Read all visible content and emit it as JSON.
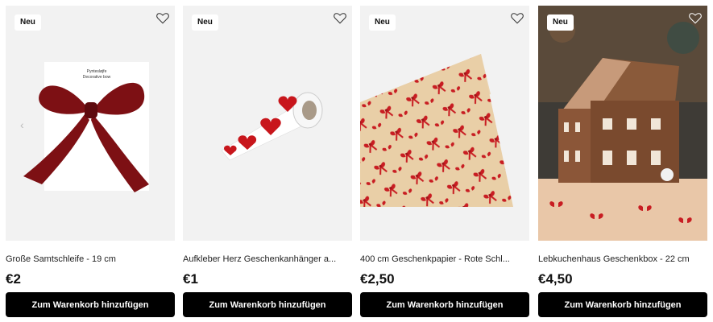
{
  "products": [
    {
      "badge": "Neu",
      "title": "Große Samtschleife - 19 cm",
      "price": "€2",
      "button": "Zum Warenkorb hinzufügen",
      "package_text": "Pyntesløjfe\nDecorative bow"
    },
    {
      "badge": "Neu",
      "title": "Aufkleber Herz Geschenkanhänger a...",
      "price": "€1",
      "button": "Zum Warenkorb hinzufügen"
    },
    {
      "badge": "Neu",
      "title": "400 cm Geschenkpapier - Rote Schl...",
      "price": "€2,50",
      "button": "Zum Warenkorb hinzufügen"
    },
    {
      "badge": "Neu",
      "title": "Lebkuchenhaus Geschenkbox - 22 cm",
      "price": "€4,50",
      "button": "Zum Warenkorb hinzufügen"
    }
  ],
  "icons": {
    "wishlist": "heart-outline-icon",
    "carousel_prev": "chevron-left-icon"
  },
  "colors": {
    "button_bg": "#000000",
    "button_text": "#ffffff",
    "image_bg": "#f2f2f2",
    "accent_red": "#b0171e"
  }
}
